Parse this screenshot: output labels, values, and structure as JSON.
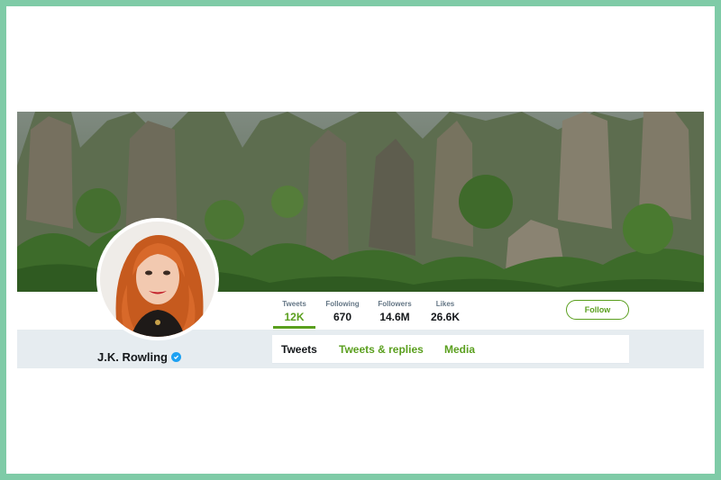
{
  "profile": {
    "name": "J.K. Rowling",
    "verified": true
  },
  "stats": [
    {
      "label": "Tweets",
      "value": "12K",
      "active": true
    },
    {
      "label": "Following",
      "value": "670",
      "active": false
    },
    {
      "label": "Followers",
      "value": "14.6M",
      "active": false
    },
    {
      "label": "Likes",
      "value": "26.6K",
      "active": false
    }
  ],
  "follow_button": {
    "label": "Follow"
  },
  "tabs": [
    {
      "label": "Tweets",
      "active": true
    },
    {
      "label": "Tweets & replies",
      "active": false
    },
    {
      "label": "Media",
      "active": false
    }
  ],
  "colors": {
    "accent": "#5a9f1e",
    "frame": "#7fcba7",
    "verified": "#1da1f2",
    "band": "#e6ecf0"
  },
  "icons": {
    "verified": "verified-badge-icon"
  }
}
